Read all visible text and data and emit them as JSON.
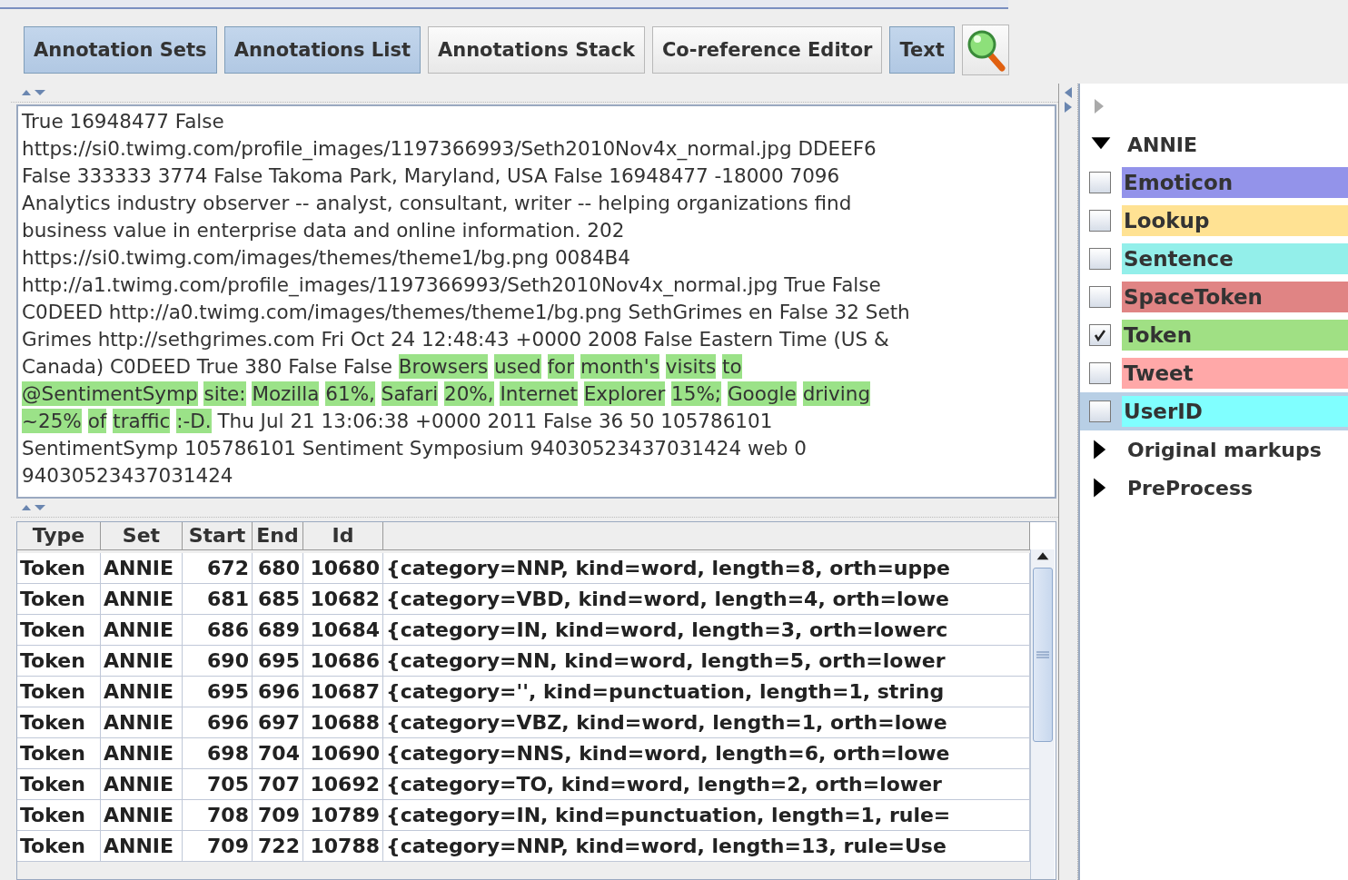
{
  "toolbar": {
    "buttons": [
      {
        "label": "Annotation Sets",
        "selected": true
      },
      {
        "label": "Annotations List",
        "selected": true
      },
      {
        "label": "Annotations Stack",
        "selected": false
      },
      {
        "label": "Co-reference Editor",
        "selected": false
      },
      {
        "label": "Text",
        "selected": true
      }
    ]
  },
  "document": {
    "lines": [
      [
        {
          "text": "True 16948477 False",
          "highlighted": false
        }
      ],
      [
        {
          "text": "https://si0.twimg.com/profile_images/1197366993/Seth2010Nov4x_normal.jpg DDEEF6",
          "highlighted": false
        }
      ],
      [
        {
          "text": "False 333333 3774 False Takoma Park, Maryland, USA False 16948477 -18000 7096",
          "highlighted": false
        }
      ],
      [
        {
          "text": "Analytics industry observer -- analyst, consultant, writer -- helping organizations find",
          "highlighted": false
        }
      ],
      [
        {
          "text": "business value in enterprise data and online information. 202",
          "highlighted": false
        }
      ],
      [
        {
          "text": "https://si0.twimg.com/images/themes/theme1/bg.png 0084B4",
          "highlighted": false
        }
      ],
      [
        {
          "text": "http://a1.twimg.com/profile_images/1197366993/Seth2010Nov4x_normal.jpg True False",
          "highlighted": false
        }
      ],
      [
        {
          "text": "C0DEED http://a0.twimg.com/images/themes/theme1/bg.png SethGrimes en False 32 Seth",
          "highlighted": false
        }
      ],
      [
        {
          "text": "Grimes http://sethgrimes.com Fri Oct 24 12:48:43 +0000 2008 False Eastern Time (US &",
          "highlighted": false
        }
      ],
      [
        {
          "text": "Canada) C0DEED True 380 False False ",
          "highlighted": false
        },
        {
          "text": "Browsers used for month's visits to",
          "highlighted": true
        }
      ],
      [
        {
          "text": "@SentimentSymp site: Mozilla 61%, Safari 20%, Internet Explorer 15%; Google driving",
          "highlighted": true
        }
      ],
      [
        {
          "text": "~25% of traffic :-D.",
          "highlighted": true
        },
        {
          "text": " Thu Jul 21 13:06:38 +0000 2011 False 36 50 105786101",
          "highlighted": false
        }
      ],
      [
        {
          "text": "SentimentSymp 105786101 Sentiment Symposium 94030523437031424 web 0",
          "highlighted": false
        }
      ],
      [
        {
          "text": "94030523437031424",
          "highlighted": false
        }
      ]
    ]
  },
  "table": {
    "columns": [
      "Type",
      "Set",
      "Start",
      "End",
      "Id"
    ],
    "rows": [
      [
        "Token",
        "ANNIE",
        "672",
        "680",
        "10680",
        "{category=NNP, kind=word, length=8, orth=uppe"
      ],
      [
        "Token",
        "ANNIE",
        "681",
        "685",
        "10682",
        "{category=VBD, kind=word, length=4, orth=lowe"
      ],
      [
        "Token",
        "ANNIE",
        "686",
        "689",
        "10684",
        "{category=IN, kind=word, length=3, orth=lowerc"
      ],
      [
        "Token",
        "ANNIE",
        "690",
        "695",
        "10686",
        "{category=NN, kind=word, length=5, orth=lower"
      ],
      [
        "Token",
        "ANNIE",
        "695",
        "696",
        "10687",
        "{category='', kind=punctuation, length=1, string"
      ],
      [
        "Token",
        "ANNIE",
        "696",
        "697",
        "10688",
        "{category=VBZ, kind=word, length=1, orth=lowe"
      ],
      [
        "Token",
        "ANNIE",
        "698",
        "704",
        "10690",
        "{category=NNS, kind=word, length=6, orth=lowe"
      ],
      [
        "Token",
        "ANNIE",
        "705",
        "707",
        "10692",
        "{category=TO, kind=word, length=2, orth=lower"
      ],
      [
        "Token",
        "ANNIE",
        "708",
        "709",
        "10789",
        "{category=IN, kind=punctuation, length=1, rule="
      ],
      [
        "Token",
        "ANNIE",
        "709",
        "722",
        "10788",
        "{category=NNP, kind=word, length=13, rule=Use"
      ]
    ]
  },
  "sets": [
    {
      "name": "ANNIE",
      "expanded": true,
      "types": [
        {
          "name": "Emoticon",
          "checked": false,
          "selected": false,
          "color": "#9393ea"
        },
        {
          "name": "Lookup",
          "checked": false,
          "selected": false,
          "color": "#ffe293"
        },
        {
          "name": "Sentence",
          "checked": false,
          "selected": false,
          "color": "#93efea"
        },
        {
          "name": "SpaceToken",
          "checked": false,
          "selected": false,
          "color": "#e08484"
        },
        {
          "name": "Token",
          "checked": true,
          "selected": false,
          "color": "#a0e084"
        },
        {
          "name": "Tweet",
          "checked": false,
          "selected": false,
          "color": "#ffa8a8"
        },
        {
          "name": "UserID",
          "checked": false,
          "selected": true,
          "color": "#80ffff"
        }
      ]
    },
    {
      "name": "Original markups",
      "expanded": false
    },
    {
      "name": "PreProcess",
      "expanded": false
    }
  ]
}
